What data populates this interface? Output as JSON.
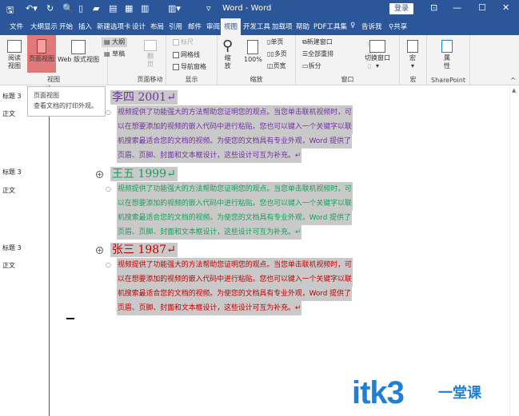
{
  "titlebar": {
    "title": "Word - Word",
    "login": "登录",
    "minimize": "—",
    "maximize": "☐",
    "close": "✕",
    "restore": "⊡"
  },
  "tabs": [
    "文件",
    "大纲显示",
    "开始",
    "插入",
    "新建选项卡",
    "设计",
    "布局",
    "引用",
    "邮件",
    "审阅",
    "视图",
    "开发工具",
    "加载项",
    "帮助",
    "PDF工具集",
    "告诉我",
    "共享"
  ],
  "active_tab": "视图",
  "ribbon": {
    "views": {
      "label": "视图",
      "read": "阅读\n视图",
      "print": "页面视图",
      "web": "Web 版式视图",
      "outline": "大纲",
      "draft": "草稿"
    },
    "page_move": {
      "label": "页面移动",
      "flip": "翻\n页"
    },
    "show": {
      "label": "显示",
      "ruler": "标尺",
      "gridlines": "网格线",
      "nav_pane": "导航窗格"
    },
    "zoom": {
      "label": "缩放",
      "zoom": "缩\n放",
      "pct": "100%",
      "one_page": "单页",
      "multi_page": "多页",
      "page_width": "页宽"
    },
    "window": {
      "label": "窗口",
      "new_window": "新建窗口",
      "arrange_all": "全部重排",
      "split": "拆分",
      "switch": "切换窗口"
    },
    "macros": {
      "label": "宏",
      "macro": "宏"
    },
    "sharepoint": {
      "label": "SharePoint",
      "props": "属\n性"
    }
  },
  "tooltip": {
    "title": "页面视图",
    "desc": "查看文档的打印外观。"
  },
  "style_labels": [
    "标题 3",
    "正文",
    "标题 3",
    "正文",
    "标题 3",
    "正文"
  ],
  "sections": [
    {
      "heading": "李四 2001↵",
      "color": "#7030a0"
    },
    {
      "heading": "王五 1999↵",
      "color": "#16a05a"
    },
    {
      "heading": "张三 1987↵",
      "color": "#c00000"
    }
  ],
  "paragraph_lines": [
    "视频提供了功能强大的方法帮助您证明您的观点。当您单击联机视频时，可",
    "以在想要添加的视频的嵌入代码中进行粘贴。您也可以键入一个关键字以联",
    "机搜索最适合您的文档的视频。为使您的文档具有专业外观，Word 提供了",
    "页眉、页脚、封面和文本框设计，这些设计可互为补充。↵"
  ],
  "watermark": {
    "brand": "itk3",
    "sub": "一堂课"
  }
}
